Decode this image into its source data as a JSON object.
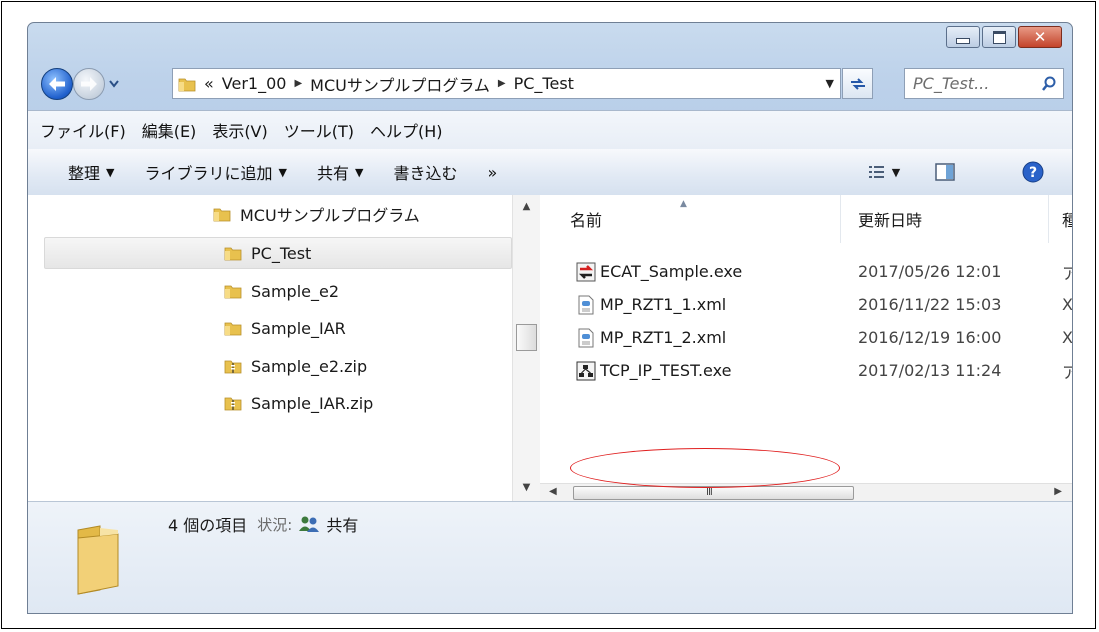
{
  "window": {
    "caption_buttons": [
      "minimize",
      "maximize",
      "close"
    ]
  },
  "address_bar": {
    "overflow": "«",
    "crumbs": [
      "Ver1_00",
      "MCUサンプルプログラム",
      "PC_Test"
    ]
  },
  "search": {
    "placeholder": "PC_Test..."
  },
  "menu": [
    "ファイル(F)",
    "編集(E)",
    "表示(V)",
    "ツール(T)",
    "ヘルプ(H)"
  ],
  "toolbar": {
    "organize": "整理",
    "add_to_library": "ライブラリに追加",
    "share": "共有",
    "burn": "書き込む",
    "more": "»"
  },
  "nav_pane": {
    "items": [
      {
        "label": "MCUサンプルプログラム",
        "icon": "folder-icon",
        "selected": false
      },
      {
        "label": "PC_Test",
        "icon": "folder-icon",
        "selected": true
      },
      {
        "label": "Sample_e2",
        "icon": "folder-icon",
        "selected": false
      },
      {
        "label": "Sample_IAR",
        "icon": "folder-icon",
        "selected": false
      },
      {
        "label": "Sample_e2.zip",
        "icon": "zip-folder-icon",
        "selected": false
      },
      {
        "label": "Sample_IAR.zip",
        "icon": "zip-folder-icon",
        "selected": false
      }
    ]
  },
  "file_list": {
    "columns": [
      "名前",
      "更新日時",
      "種"
    ],
    "rows": [
      {
        "name": "ECAT_Sample.exe",
        "date": "2017/05/26 12:01",
        "type": "ア",
        "icon": "exe-red-arrow-icon"
      },
      {
        "name": "MP_RZT1_1.xml",
        "date": "2016/11/22 15:03",
        "type": "X",
        "icon": "xml-file-icon"
      },
      {
        "name": "MP_RZT1_2.xml",
        "date": "2016/12/19 16:00",
        "type": "X",
        "icon": "xml-file-icon"
      },
      {
        "name": "TCP_IP_TEST.exe",
        "date": "2017/02/13 11:24",
        "type": "ア",
        "icon": "exe-network-icon"
      }
    ],
    "hscroll_grip": "III"
  },
  "details": {
    "count": "4 個の項目",
    "status_key": "状況:",
    "status_value": "共有"
  },
  "colors": {
    "annotation": "#e02020",
    "close_button": "#c3432a",
    "folder": "#e8c14e"
  }
}
